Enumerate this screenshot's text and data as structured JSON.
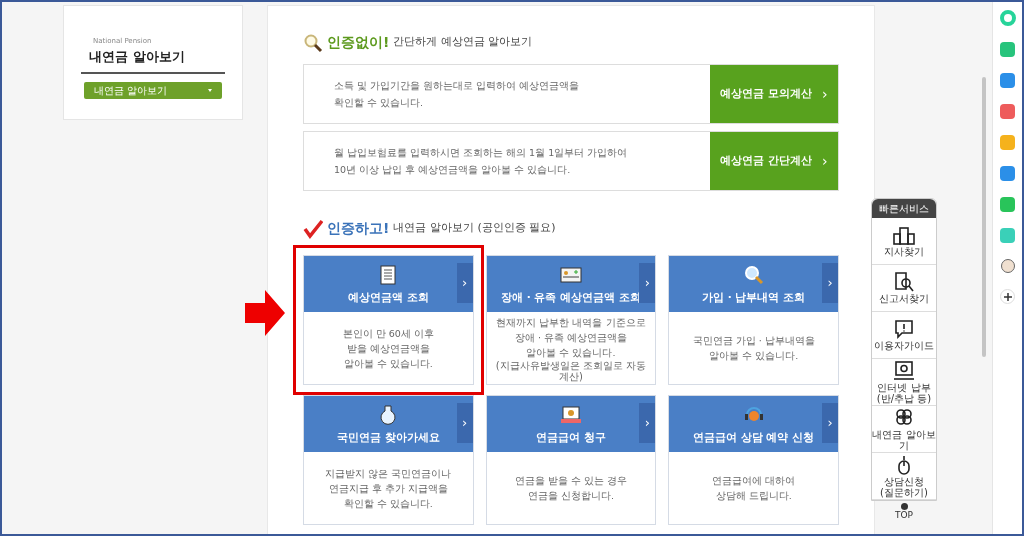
{
  "side_card": {
    "subtitle": "National Pension",
    "title": "내연금 알아보기",
    "dropdown": "내연금 알아보기"
  },
  "no_auth": {
    "heading": "인증없이!",
    "subheading": "간단하게 예상연금 알아보기",
    "rows": [
      {
        "description": "소득 및 가입기간을 원하는대로 입력하여 예상연금액을\n확인할 수 있습니다.",
        "button": "예상연금 모의계산",
        "arrow": "›"
      },
      {
        "description": "월 납입보험료를 입력하시면 조회하는 해의 1월 1일부터 가입하여\n10년 이상 납입 후 예상연금액을 알아볼 수 있습니다.",
        "button": "예상연금 간단계산",
        "arrow": "›"
      }
    ]
  },
  "with_auth": {
    "heading": "인증하고!",
    "subheading": "내연금 알아보기 (공인인증 필요)",
    "cards": [
      {
        "title": "예상연금액 조회",
        "description": "본인이 만 60세 이후\n받을 예상연금액을\n알아볼 수 있습니다.",
        "arrow": "›",
        "highlighted": true
      },
      {
        "title": "장애 · 유족 예상연금액 조회",
        "description": "현재까지 납부한 내역을 기준으로\n장애 · 유족 예상연금액을\n알아볼 수 있습니다.",
        "note": "(지급사유발생일은 조회일로 자동계산)",
        "arrow": "›",
        "highlighted": false
      },
      {
        "title": "가입 · 납부내역 조회",
        "description": "국민연금 가입 · 납부내역을\n알아볼 수 있습니다.",
        "arrow": "›",
        "highlighted": false
      },
      {
        "title": "국민연금 찾아가세요",
        "description": "지급받지 않은 국민연금이나\n연금지급 후 추가 지급액을\n확인할 수 있습니다.",
        "arrow": "›",
        "highlighted": false
      },
      {
        "title": "연금급여 청구",
        "description": "연금을 받을 수 있는 경우\n연금을 신청합니다.",
        "arrow": "›",
        "highlighted": false
      },
      {
        "title": "연금급여 상담 예약 신청",
        "description": "연금급여에 대하여\n상담해 드립니다.",
        "arrow": "›",
        "highlighted": false
      }
    ]
  },
  "quick_service": {
    "title": "빠른서비스",
    "items": [
      "지사찾기",
      "신고서찾기",
      "이용자가이드",
      "인터넷 납부\n(반/추납 등)",
      "내연금 알아보기",
      "상담신청\n(질문하기)"
    ],
    "top": "TOP"
  }
}
